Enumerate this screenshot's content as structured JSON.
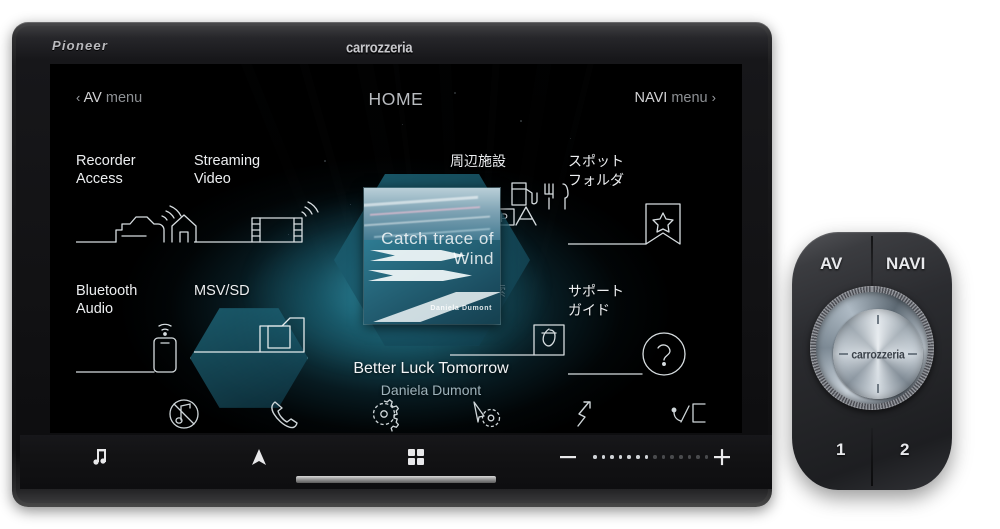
{
  "device": {
    "brand_logo": "Pioneer",
    "product_logo": "carrozzeria"
  },
  "screen": {
    "topbar": {
      "back_chevron": "‹",
      "av_menu_strong": "AV",
      "av_menu_light": "menu",
      "title": "HOME",
      "navi_menu_strong": "NAVI",
      "navi_menu_light": "menu",
      "forward_chevron": "›"
    },
    "tiles": [
      {
        "label": "Recorder\nAccess",
        "icon": "car-house-recorder-icon",
        "lang": "en",
        "highlight": false
      },
      {
        "label": "Streaming\nVideo",
        "icon": "film-wifi-streaming-icon",
        "lang": "en",
        "highlight": false
      },
      {
        "label": "周辺施設",
        "icon": "poi-fuel-food-parking-icon",
        "lang": "jp",
        "highlight": false
      },
      {
        "label": "スポット\nフォルダ",
        "icon": "bookmark-star-icon",
        "lang": "jp",
        "highlight": false
      },
      {
        "label": "Bluetooth\nAudio",
        "icon": "phone-bluetooth-wifi-icon",
        "lang": "en",
        "highlight": false
      },
      {
        "label": "MSV/SD",
        "icon": "sd-card-icon",
        "lang": "en",
        "highlight": true
      },
      {
        "label": "名称検索",
        "icon": "keyboard-a-icon",
        "lang": "jp",
        "highlight": false
      },
      {
        "label": "サポート\nガイド",
        "icon": "question-circle-icon",
        "lang": "jp",
        "highlight": false
      }
    ],
    "album": {
      "art_title": "Catch\ntrace\nof\nWind",
      "art_artist": "Daniela Dumont"
    },
    "now_playing": {
      "title": "Better Luck Tomorrow",
      "artist": "Daniela Dumont"
    },
    "shortcut_icons": [
      {
        "name": "mute-music-icon"
      },
      {
        "name": "phone-icon"
      },
      {
        "name": "gear-icon"
      },
      {
        "name": "navigation-settings-icon"
      },
      {
        "name": "route-arrow-icon"
      },
      {
        "name": "rear-camera-icon"
      }
    ]
  },
  "hardkeys": [
    {
      "name": "music-key",
      "glyph": "♫"
    },
    {
      "name": "navigation-key",
      "glyph": "▲"
    },
    {
      "name": "apps-key",
      "glyph": "grid"
    },
    {
      "name": "volume-down-key",
      "glyph": "−"
    },
    {
      "name": "volume-level",
      "glyph": "dots"
    },
    {
      "name": "volume-up-key",
      "glyph": "+"
    }
  ],
  "volume": {
    "total_dots": 14,
    "filled_dots": 7
  },
  "remote": {
    "button_av": "AV",
    "button_navi": "NAVI",
    "dial_logo": "carrozzeria",
    "button_1": "1",
    "button_2": "2"
  },
  "colors": {
    "accent_teal": "#247a8e",
    "screen_black": "#000000",
    "text_primary": "#eceef0",
    "text_secondary": "#9fb3bb",
    "bezel": "#17171a"
  }
}
